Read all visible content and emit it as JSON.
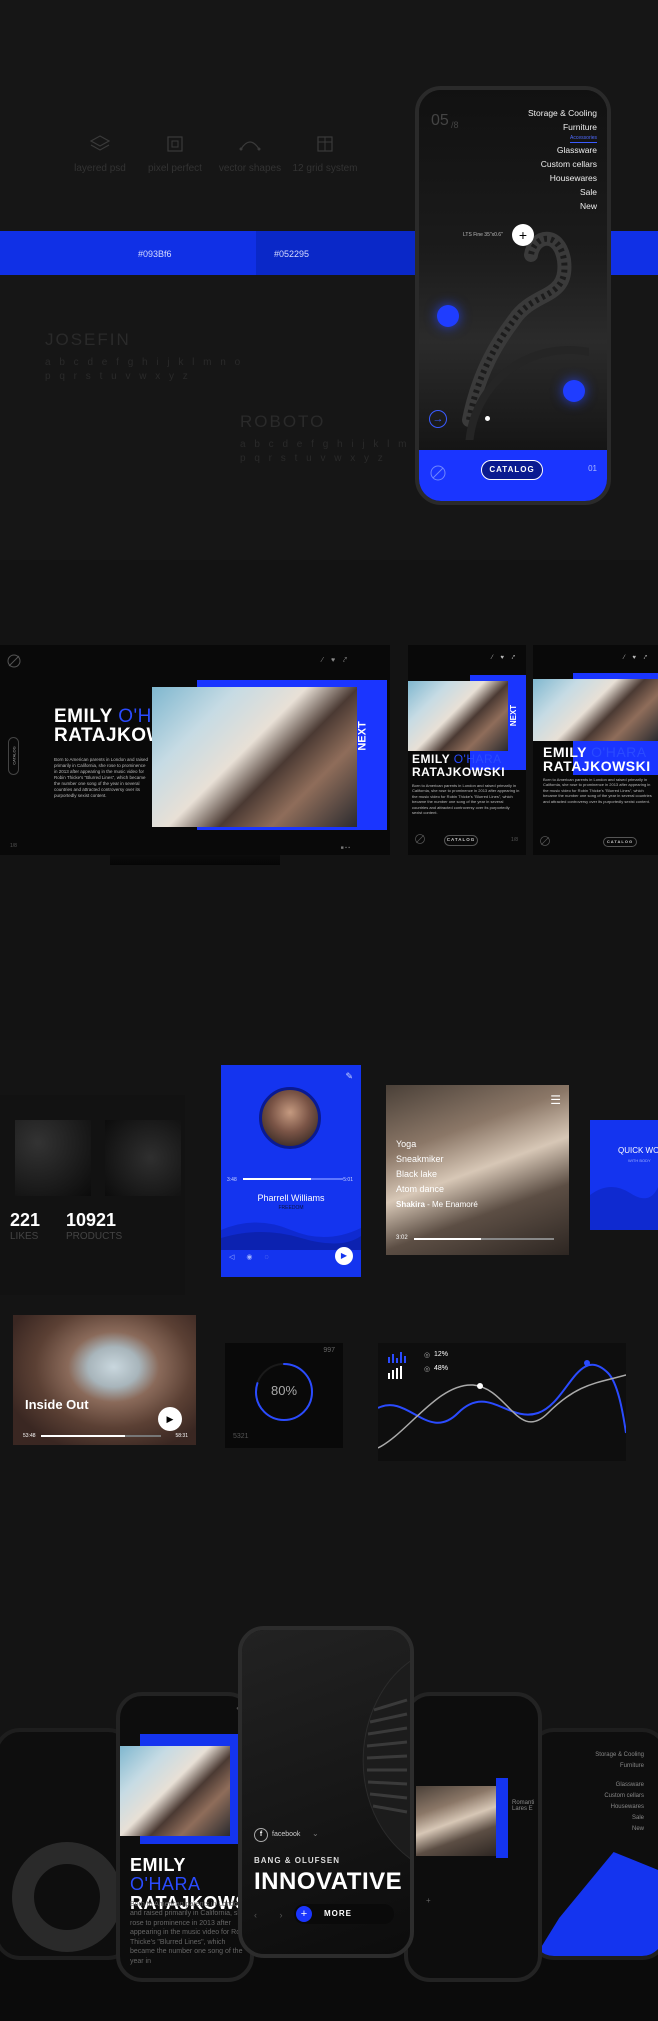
{
  "features": [
    {
      "icon": "layers-icon",
      "label": "layered psd"
    },
    {
      "icon": "pixel-icon",
      "label": "pixel perfect"
    },
    {
      "icon": "vector-icon",
      "label": "vector shapes"
    },
    {
      "icon": "grid-icon",
      "label": "12 grid system"
    }
  ],
  "colors": {
    "primary": "#093BF6",
    "secondary": "#052295",
    "primary_label": "#093Bf6",
    "secondary_label": "#052295"
  },
  "fonts": {
    "josefin": {
      "name": "JOSEFIN",
      "row1": "a b c d e f g h i j k l m n o",
      "row2": "p q r s t u v w x y z"
    },
    "roboto": {
      "name": "ROBOTO",
      "row1": "a b c d e f g h i j k l m n o",
      "row2": "p q r s t u v w x y z"
    }
  },
  "phone1": {
    "counter": "05",
    "counter_total": "/8",
    "menu_top": [
      "Storage & Cooling",
      "Furniture"
    ],
    "menu_small": "Accessories",
    "menu_items": [
      "Glassware",
      "Custom cellars",
      "Housewares",
      "Sale",
      "New"
    ],
    "product_label": "LTS Fine 35\"x0.6\"",
    "catalog": "CATALOG",
    "page": "01"
  },
  "spread": {
    "name_first": "EMILY",
    "name_alt": "O'HARA",
    "name_last": "RATAJKOWSKI",
    "bio": "Born to American parents in London and raised primarily in California, she rose to prominence in 2013 after appearing in the music video for Robin Thicke's \"Blurred Lines\", which became the number one song of the year in several countries and attracted controversy over its purportedly sexist content.",
    "next": "NEXT",
    "side_catalog": "CATALOG",
    "page": "1/8",
    "catalog": "CATALOG"
  },
  "widgets": {
    "likes_num": "221",
    "likes_label": "LIKES",
    "products_num": "10921",
    "products_label": "PRODUCTS",
    "player_time_start": "3:48",
    "player_time_end": "5:01",
    "artist": "Pharrell Williams",
    "artist_sub": "FREEDOM",
    "playlist": [
      "Yoga",
      "Sneakmiker",
      "Black lake",
      "Atom dance"
    ],
    "now_artist": "Shakira",
    "now_song": " - Me Enamoré",
    "now_time": "3:02",
    "quick_title": "QUICK WO",
    "quick_sub": "WITH BODY",
    "track_title": "Inside Out",
    "track_start": "53:48",
    "track_end": "58:31",
    "progress_value": "80%",
    "progress_top": "997",
    "progress_bottom": "5321",
    "stat1": "12%",
    "stat2": "48%"
  },
  "bottom": {
    "menu": [
      "Storage & Cooling",
      "Furniture",
      "Glassware",
      "Custom cellars",
      "Housewares",
      "Sale",
      "New"
    ],
    "social": "facebook",
    "brand": "BANG & OLUFSEN",
    "headline": "INNOVATIVE",
    "more": "MORE",
    "name_first": "EMILY",
    "name_alt": "O'HARA",
    "name_last": "RATAJKOWS",
    "bio": "Born to American parents in London and raised primarily in California, she rose to prominence in 2013 after appearing in the music video for Robin Thicke's \"Blurred Lines\", which became the number one song of the year in",
    "side_text": "Romanti Lares E"
  }
}
